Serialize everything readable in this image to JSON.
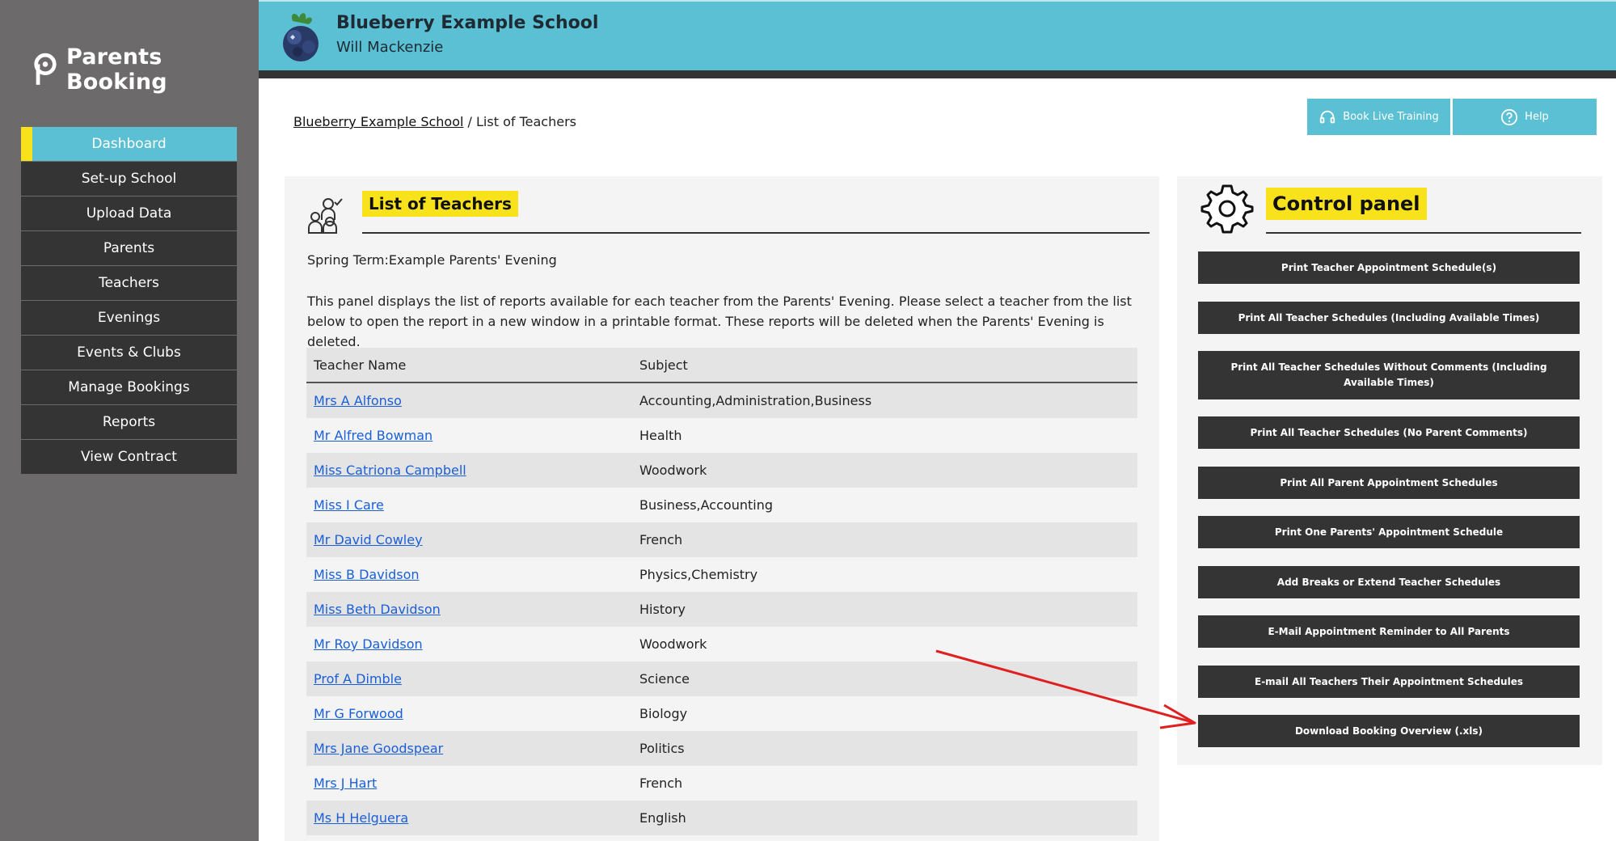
{
  "brand": {
    "name": "Parents Booking"
  },
  "header": {
    "school_name": "Blueberry Example School",
    "user_name": "Will Mackenzie"
  },
  "sidebar": {
    "items": [
      {
        "label": "Dashboard"
      },
      {
        "label": "Set-up School"
      },
      {
        "label": "Upload Data"
      },
      {
        "label": "Parents"
      },
      {
        "label": "Teachers"
      },
      {
        "label": "Evenings"
      },
      {
        "label": "Events & Clubs"
      },
      {
        "label": "Manage Bookings"
      },
      {
        "label": "Reports"
      },
      {
        "label": "View Contract"
      }
    ]
  },
  "breadcrumb": {
    "root": "Blueberry Example School",
    "separator": " / ",
    "current": "List of Teachers"
  },
  "top_buttons": {
    "training": "Book Live Training",
    "help": "Help"
  },
  "main": {
    "title": "List of Teachers",
    "term": "Spring Term:Example Parents' Evening",
    "description": "This panel displays the list of reports available for each teacher from the Parents' Evening. Please select a teacher from the list below to open the report in a new window in a printable format. These reports will be deleted when the Parents' Evening is deleted.",
    "table": {
      "headers": [
        "Teacher Name",
        "Subject"
      ],
      "rows": [
        {
          "name": "Mrs A Alfonso",
          "subject": "Accounting,Administration,Business"
        },
        {
          "name": "Mr Alfred Bowman",
          "subject": "Health"
        },
        {
          "name": "Miss Catriona Campbell",
          "subject": "Woodwork"
        },
        {
          "name": "Miss I Care",
          "subject": "Business,Accounting"
        },
        {
          "name": "Mr David Cowley",
          "subject": "French"
        },
        {
          "name": "Miss B Davidson",
          "subject": "Physics,Chemistry"
        },
        {
          "name": "Miss Beth Davidson",
          "subject": "History"
        },
        {
          "name": "Mr Roy Davidson",
          "subject": "Woodwork"
        },
        {
          "name": "Prof A Dimble",
          "subject": "Science"
        },
        {
          "name": "Mr G Forwood",
          "subject": "Biology"
        },
        {
          "name": "Mrs Jane Goodspear",
          "subject": "Politics"
        },
        {
          "name": "Mrs J Hart",
          "subject": "French"
        },
        {
          "name": "Ms H Helguera",
          "subject": "English"
        }
      ]
    }
  },
  "control_panel": {
    "title": "Control panel",
    "buttons": [
      "Print Teacher Appointment Schedule(s)",
      "Print All Teacher Schedules (Including Available Times)",
      "Print All Teacher Schedules Without Comments (Including Available Times)",
      "Print All Teacher Schedules (No Parent Comments)",
      "Print All Parent Appointment Schedules",
      "Print One Parents' Appointment Schedule",
      "Add Breaks or Extend Teacher Schedules",
      "E-Mail Appointment Reminder to All Parents",
      "E-mail All Teachers Their Appointment Schedules",
      "Download Booking Overview (.xls)"
    ]
  },
  "colors": {
    "accent": "#5bc0d4",
    "highlight": "#f7e21b",
    "dark": "#343434",
    "sidebar": "#6c6a6b",
    "link": "#1a5fd8",
    "arrow": "#e02020"
  }
}
